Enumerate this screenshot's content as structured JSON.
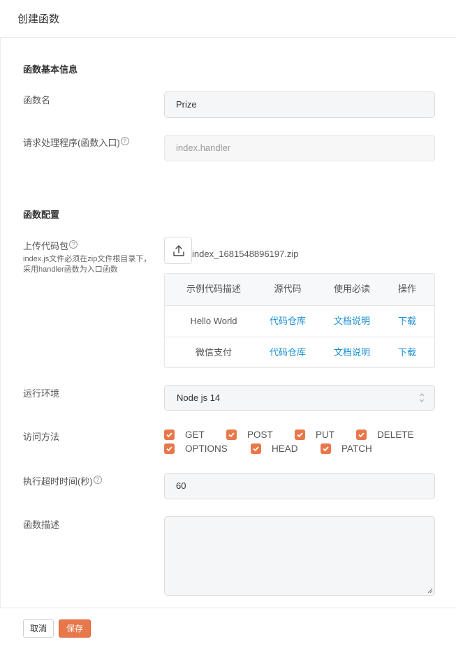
{
  "header": {
    "title": "创建函数"
  },
  "basic": {
    "section_title": "函数基本信息",
    "name_label": "函数名",
    "name_value": "Prize",
    "handler_label": "请求处理程序(函数入口)",
    "handler_value": "index.handler"
  },
  "config": {
    "section_title": "函数配置",
    "upload_label": "上传代码包",
    "upload_hint": "index.js文件必须在zip文件根目录下，采用handler函数为入口函数",
    "file_name": "index_1681548896197.zip",
    "table": {
      "headers": [
        "示例代码描述",
        "源代码",
        "使用必读",
        "操作"
      ],
      "rows": [
        [
          "Hello World",
          "代码仓库",
          "文档说明",
          "下载"
        ],
        [
          "微信支付",
          "代码仓库",
          "文档说明",
          "下载"
        ]
      ]
    },
    "runtime_label": "运行环境",
    "runtime_value": "Node js 14",
    "methods_label": "访问方法",
    "methods": [
      {
        "label": "GET",
        "checked": true
      },
      {
        "label": "POST",
        "checked": true
      },
      {
        "label": "PUT",
        "checked": true
      },
      {
        "label": "DELETE",
        "checked": true
      },
      {
        "label": "OPTIONS",
        "checked": true
      },
      {
        "label": "HEAD",
        "checked": true
      },
      {
        "label": "PATCH",
        "checked": true
      }
    ],
    "timeout_label": "执行超时时间(秒)",
    "timeout_value": "60",
    "desc_label": "函数描述",
    "desc_value": ""
  },
  "footer": {
    "cancel_label": "取消",
    "save_label": "保存"
  },
  "colors": {
    "accent": "#e8774a",
    "link": "#1a8fd6"
  },
  "icons": {
    "help": "question-circle-icon",
    "upload": "upload-icon",
    "select": "chevron-up-down-icon",
    "check": "check-icon"
  }
}
